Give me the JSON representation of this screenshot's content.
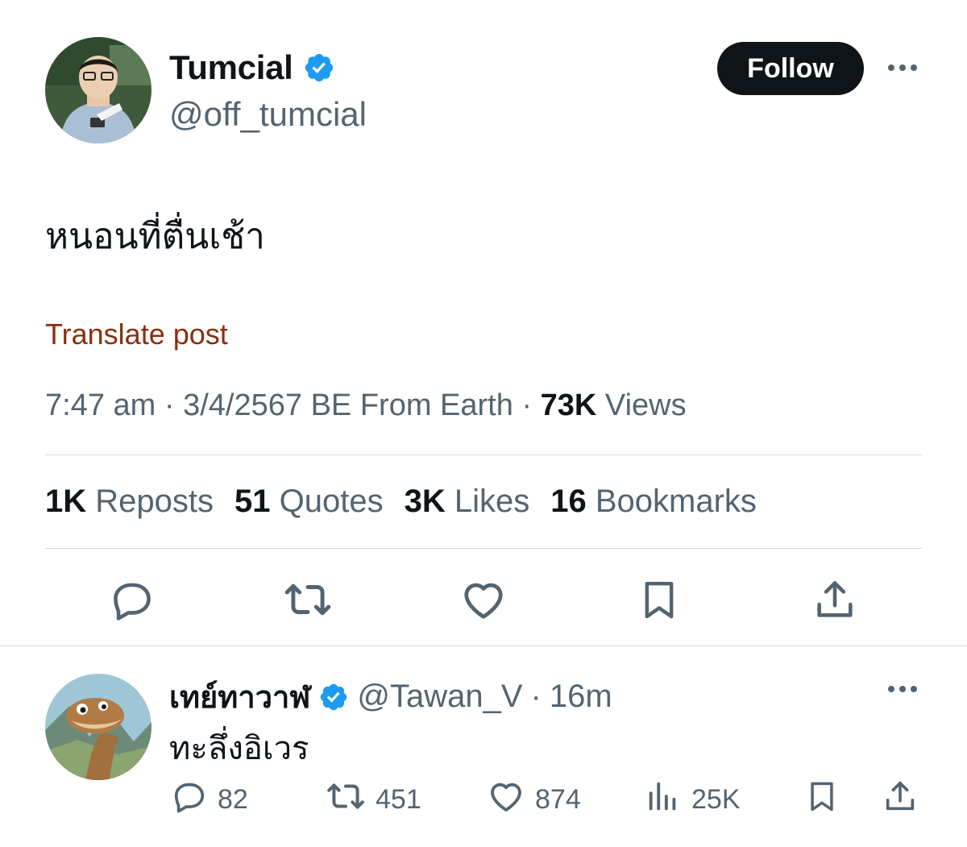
{
  "post": {
    "author": {
      "display_name": "Tumcial",
      "handle": "@off_tumcial",
      "verified": true
    },
    "follow_label": "Follow",
    "text": "หนอนที่ตื่นเช้า",
    "translate_label": "Translate post",
    "meta": {
      "time": "7:47 am",
      "sep1": " · ",
      "date": "3/4/2567 BE",
      "source": " From Earth",
      "sep2": " · ",
      "views_count": "73K",
      "views_label": " Views"
    },
    "stats": [
      {
        "count": "1K",
        "label": " Reposts"
      },
      {
        "count": "51",
        "label": " Quotes"
      },
      {
        "count": "3K",
        "label": " Likes"
      },
      {
        "count": "16",
        "label": " Bookmarks"
      }
    ]
  },
  "reply": {
    "display_name": "เทย์ทาวาฬ",
    "handle": "@Tawan_V",
    "sep": " · ",
    "time": "16m",
    "text": "ทะลึ่งอิเวร",
    "counts": {
      "replies": "82",
      "reposts": "451",
      "likes": "874",
      "views": "25K"
    }
  },
  "colors": {
    "text": "#0f1419",
    "secondary": "#536471",
    "verified_blue": "#1d9bf0",
    "translate": "#8b2f0d",
    "divider": "#d5dbe0"
  },
  "icons": [
    "verified-badge-icon",
    "more-icon",
    "reply-icon",
    "repost-icon",
    "like-icon",
    "bookmark-icon",
    "share-icon",
    "views-icon"
  ]
}
